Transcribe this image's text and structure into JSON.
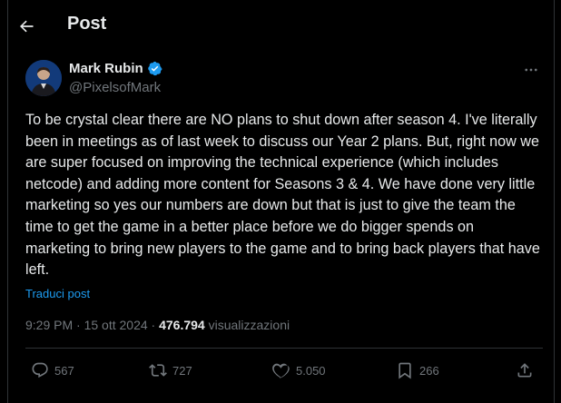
{
  "header": {
    "title": "Post",
    "back_icon": "arrow-left-icon"
  },
  "author": {
    "name": "Mark Rubin",
    "handle": "@PixelsofMark",
    "verified": true,
    "verified_color": "#1d9bf0"
  },
  "post": {
    "text": "To be crystal clear there are NO plans to shut down after season 4. I've literally been in meetings as of last week to discuss our Year 2 plans. But, right now we are super focused on improving the technical experience (which includes netcode) and adding more content for Seasons 3 & 4. We have done very little marketing so yes our numbers are down but that is just to give the team the time to get the game in a better place before we do bigger spends on marketing to bring new players to the game and to bring back players that have left.",
    "translate_label": "Traduci post",
    "time": "9:29 PM",
    "separator": "·",
    "date": "15 ott 2024",
    "views_count": "476.794",
    "views_label": "visualizzazioni"
  },
  "actions": {
    "replies": "567",
    "reposts": "727",
    "likes": "5.050",
    "bookmarks": "266"
  },
  "colors": {
    "background": "#000000",
    "text": "#e7e9ea",
    "muted": "#71767b",
    "accent": "#1d9bf0",
    "border": "#2f3336"
  }
}
